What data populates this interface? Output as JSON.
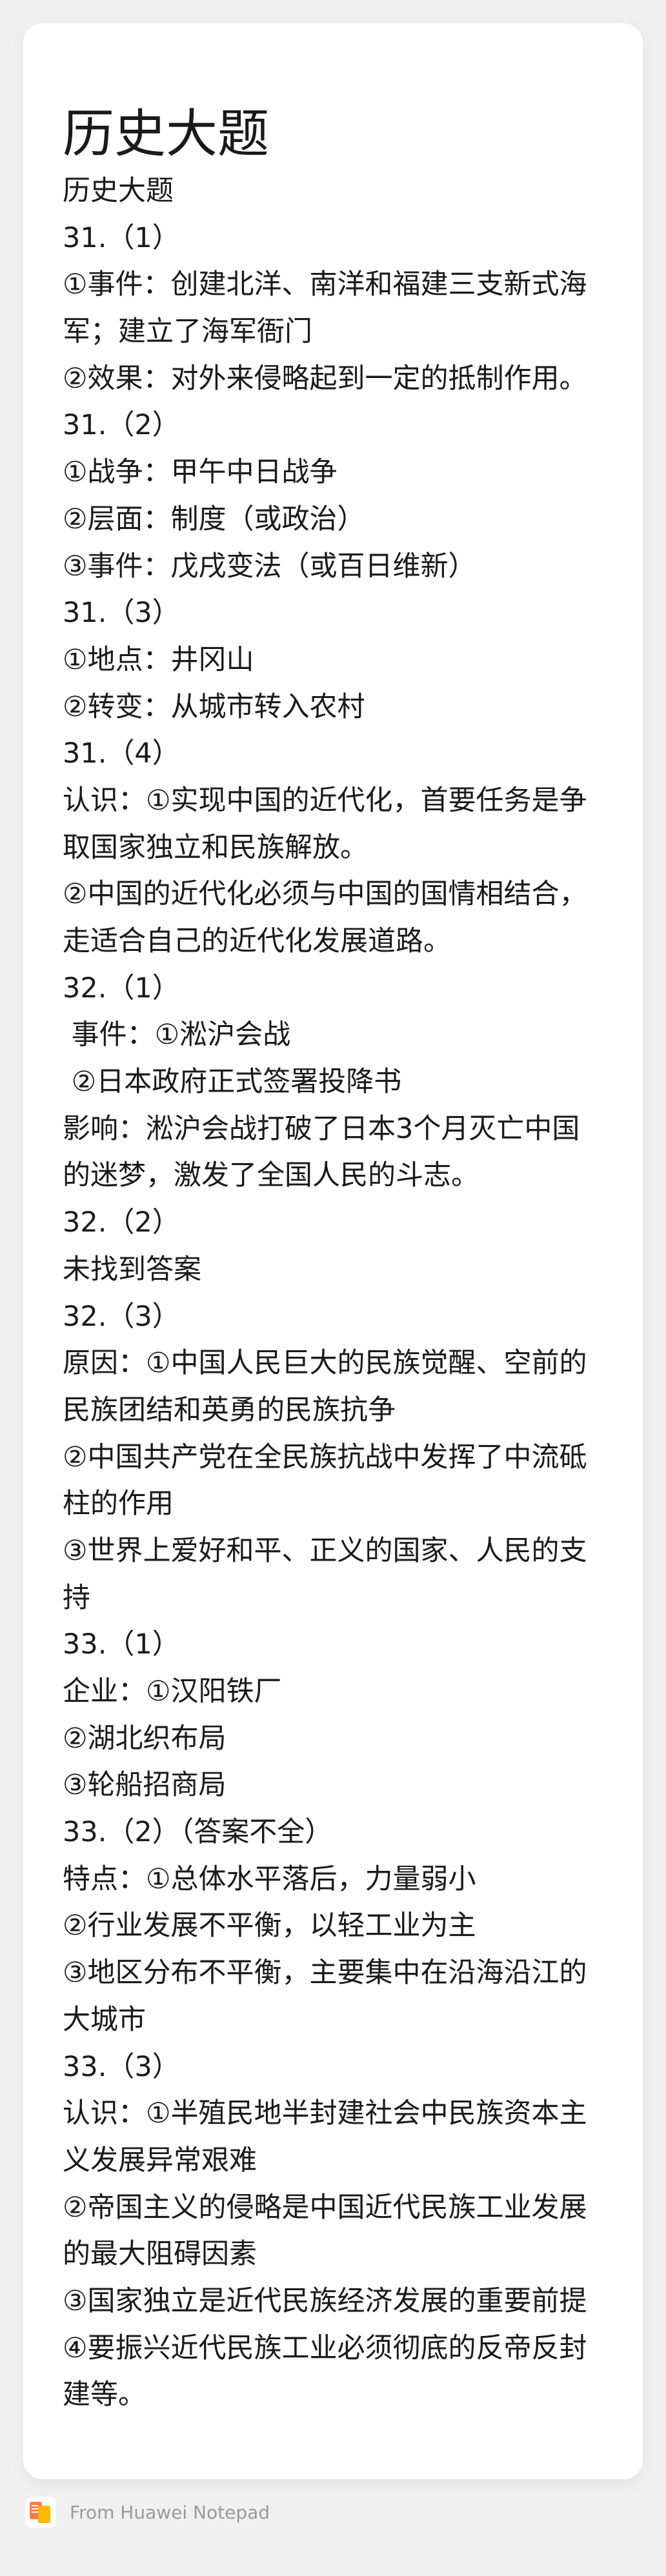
{
  "note": {
    "title": "历史大题",
    "lines": [
      "历史大题",
      "31.（1）",
      "①事件：创建北洋、南洋和福建三支新式海",
      "军；建立了海军衙门",
      "②效果：对外来侵略起到一定的抵制作用。",
      "31.（2）",
      "①战争：甲午中日战争",
      "②层面：制度（或政治）",
      "③事件：戊戌变法（或百日维新）",
      "31.（3）",
      "①地点：井冈山",
      "②转变：从城市转入农村",
      "31.（4）",
      "认识：①实现中国的近代化，首要任务是争",
      "取国家独立和民族解放。",
      "②中国的近代化必须与中国的国情相结合，",
      "走适合自己的近代化发展道路。",
      "32.（1）",
      " 事件：①淞沪会战",
      " ②日本政府正式签署投降书",
      "影响：淞沪会战打破了日本3个月灭亡中国",
      "的迷梦，激发了全国人民的斗志。",
      "32.（2）",
      "未找到答案",
      "32.（3）",
      "原因：①中国人民巨大的民族觉醒、空前的",
      "民族团结和英勇的民族抗争",
      "②中国共产党在全民族抗战中发挥了中流砥",
      "柱的作用",
      "③世界上爱好和平、正义的国家、人民的支",
      "持",
      "33.（1）",
      "企业：①汉阳铁厂",
      "②湖北织布局",
      "③轮船招商局",
      "33.（2）（答案不全）",
      "特点：①总体水平落后，力量弱小",
      "②行业发展不平衡，以轻工业为主",
      "③地区分布不平衡，主要集中在沿海沿江的",
      "大城市",
      "33.（3）",
      "认识：①半殖民地半封建社会中民族资本主",
      "义发展异常艰难",
      "②帝国主义的侵略是中国近代民族工业发展",
      "的最大阻碍因素",
      "③国家独立是近代民族经济发展的重要前提",
      "④要振兴近代民族工业必须彻底的反帝反封",
      "建等。"
    ]
  },
  "footer": {
    "text": "From Huawei Notepad",
    "icon": "notepad-app-icon"
  },
  "colors": {
    "background": "#f0f0f0",
    "card": "#ffffff",
    "text": "#1a1a1a",
    "footer_text": "#9a9a9a"
  }
}
